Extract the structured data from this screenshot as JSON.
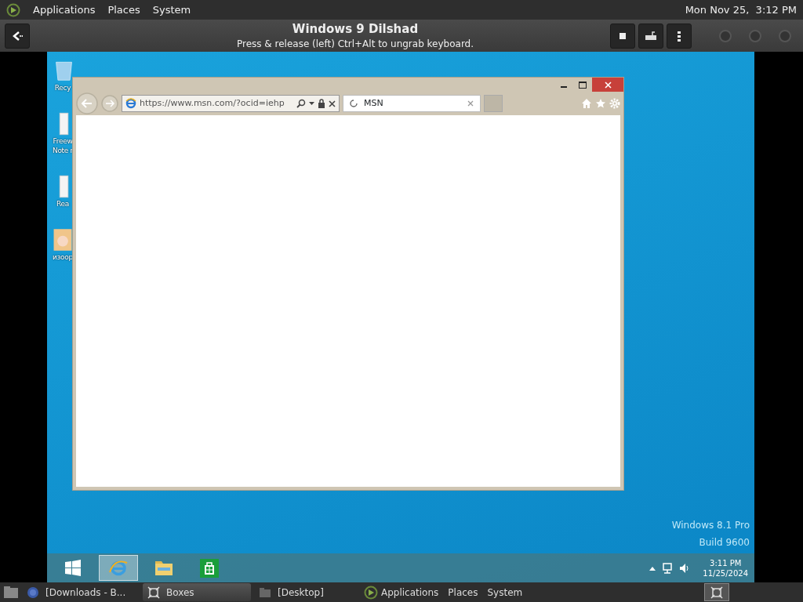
{
  "top_panel": {
    "menus": [
      "Applications",
      "Places",
      "System"
    ],
    "clock": "Mon Nov 25,  3:12 PM"
  },
  "header": {
    "title": "Windows 9 Dilshad",
    "subtitle": "Press & release (left) Ctrl+Alt to ungrab keyboard."
  },
  "desktop": {
    "icons": [
      {
        "kind": "bin",
        "lines": [
          "Recy"
        ]
      },
      {
        "kind": "doc",
        "lines": [
          "Freew",
          "Note r"
        ]
      },
      {
        "kind": "doc",
        "lines": [
          "Rea"
        ]
      },
      {
        "kind": "picture",
        "lines": [
          "изоор"
        ]
      }
    ]
  },
  "browser": {
    "address": "https://www.msn.com/?ocid=iehp",
    "tabs": [
      {
        "title": "MSN",
        "selected": true
      }
    ]
  },
  "watermark": [
    "Windows 8.1 Pro",
    "Build 9600"
  ],
  "taskbar": {
    "apps": [
      {
        "kind": "windows",
        "selected": false
      },
      {
        "kind": "ie",
        "selected": true
      },
      {
        "kind": "explorer",
        "selected": false
      },
      {
        "kind": "store",
        "selected": false
      }
    ],
    "time": "3:11 PM",
    "date": "11/25/2024"
  },
  "bottom_panel": {
    "tasks": [
      {
        "kind": "browser",
        "label": "[Downloads - B...",
        "selected": false
      },
      {
        "kind": "boxes",
        "label": "Boxes",
        "selected": true
      },
      {
        "kind": "folder",
        "label": "[Desktop]",
        "selected": false
      }
    ],
    "menus": [
      "Applications",
      "Places",
      "System"
    ]
  }
}
